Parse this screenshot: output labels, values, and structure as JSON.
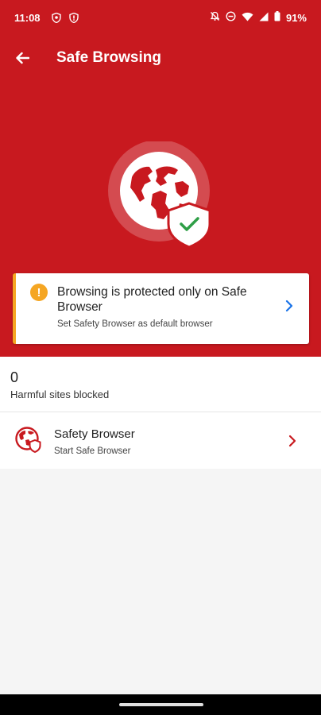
{
  "status": {
    "time": "11:08",
    "battery": "91%",
    "left_icons": [
      "shield-badge-icon",
      "shield-alert-icon"
    ],
    "right_icons": [
      "bell-off-icon",
      "do-not-disturb-icon",
      "wifi-icon",
      "signal-icon",
      "battery-icon"
    ]
  },
  "appbar": {
    "title": "Safe Browsing",
    "back_icon": "arrow-back-icon"
  },
  "colors": {
    "brand_red": "#c8191f",
    "warning": "#f5a623",
    "link_blue": "#1a73e8",
    "check_green": "#2e9e46"
  },
  "banner": {
    "title": "Browsing is protected only on Safe Browser",
    "subtitle": "Set Safety Browser as default browser",
    "icon": "warning-icon"
  },
  "stats": {
    "count": "0",
    "label": "Harmful sites blocked"
  },
  "list": [
    {
      "title": "Safety Browser",
      "subtitle": "Start Safe Browser",
      "icon": "globe-shield-icon"
    }
  ]
}
